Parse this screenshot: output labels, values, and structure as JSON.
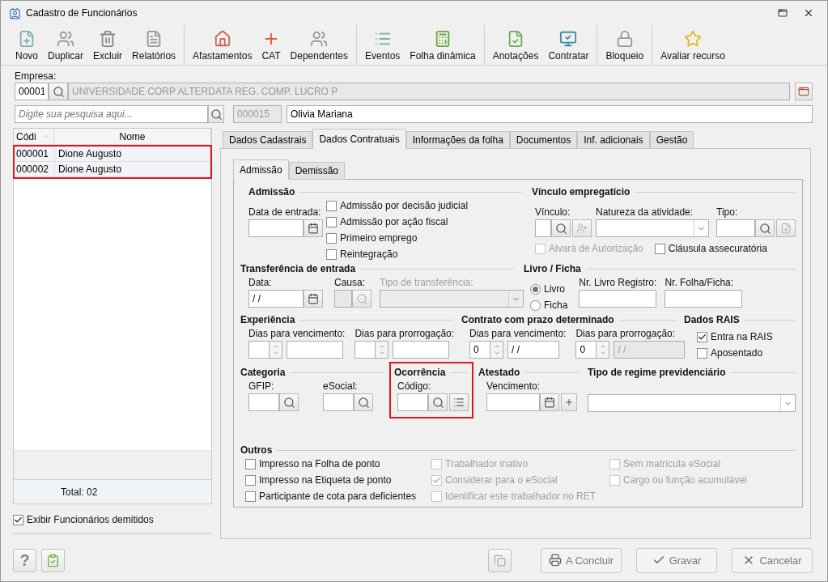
{
  "window": {
    "title": "Cadastro de Funcionários"
  },
  "toolbar": [
    [
      {
        "label": "Novo",
        "kind": "new"
      },
      {
        "label": "Duplicar",
        "kind": "people"
      },
      {
        "label": "Excluir",
        "kind": "trash"
      },
      {
        "label": "Relatórios",
        "kind": "report"
      }
    ],
    [
      {
        "label": "Afastamentos",
        "kind": "leave"
      },
      {
        "label": "CAT",
        "kind": "cross"
      },
      {
        "label": "Dependentes",
        "kind": "people"
      }
    ],
    [
      {
        "label": "Eventos",
        "kind": "list"
      },
      {
        "label": "Folha dinâmica",
        "kind": "calc"
      }
    ],
    [
      {
        "label": "Anotações",
        "kind": "note"
      },
      {
        "label": "Contratar",
        "kind": "hire"
      }
    ],
    [
      {
        "label": "Bloqueio",
        "kind": "lock"
      }
    ],
    [
      {
        "label": "Avaliar recurso",
        "kind": "star"
      }
    ]
  ],
  "empresa": {
    "label": "Empresa:",
    "code": "00001",
    "name": "UNIVERSIDADE CORP ALTERDATA REG. COMP. LUCRO P"
  },
  "search": {
    "placeholder": "Digite sua pesquisa aqui..."
  },
  "employee": {
    "code": "000015",
    "name": "Olivia Mariana"
  },
  "employee_list": {
    "columns": [
      "Códi",
      "Nome"
    ],
    "highlighted": true,
    "rows": [
      {
        "code": "000001",
        "name": "Dione Augusto"
      },
      {
        "code": "000002",
        "name": "Dione Augusto"
      }
    ],
    "total": "Total: 02"
  },
  "show_dismissed": {
    "label": "Exibir Funcionários demitidos",
    "checked": true
  },
  "help_button": "?",
  "tabs": [
    {
      "label": "Dados Cadastrais",
      "selected": false
    },
    {
      "label": "Dados Contratuais",
      "selected": true
    },
    {
      "label": "Informações da folha",
      "selected": false
    },
    {
      "label": "Documentos",
      "selected": false
    },
    {
      "label": "Inf. adicionais",
      "selected": false
    },
    {
      "label": "Gestão",
      "selected": false
    }
  ],
  "subtabs": [
    {
      "label": "Admissão",
      "selected": true
    },
    {
      "label": "Demissão",
      "selected": false
    }
  ],
  "admissao": {
    "title": "Admissão",
    "date_label": "Data de entrada:",
    "options": [
      {
        "label": "Admissão por decisão judicial",
        "checked": false,
        "disabled": false
      },
      {
        "label": "Admissão por ação fiscal",
        "checked": false,
        "disabled": false
      },
      {
        "label": "Primeiro emprego",
        "checked": false,
        "disabled": false
      },
      {
        "label": "Reintegração",
        "checked": false,
        "disabled": false
      }
    ]
  },
  "vinculo": {
    "title": "Vínculo empregatício",
    "vinculo_label": "Vínculo:",
    "natureza_label": "Natureza da atividade:",
    "tipo_label": "Tipo:",
    "options": [
      {
        "label": "Alvará de Autorização",
        "checked": false,
        "disabled": true
      },
      {
        "label": "Cláusula assecuratória",
        "checked": false,
        "disabled": false
      }
    ]
  },
  "transferencia": {
    "title": "Transferência de entrada",
    "data_label": "Data:",
    "data_value": "/ /",
    "causa_label": "Causa:",
    "tipo_label": "Tipo de transferência:",
    "tipo_disabled": true
  },
  "livro": {
    "title": "Livro / Ficha",
    "options": [
      {
        "label": "Livro",
        "selected": true
      },
      {
        "label": "Ficha",
        "selected": false
      }
    ],
    "registro_label": "Nr. Livro Registro:",
    "folha_label": "Nr. Folha/Ficha:"
  },
  "experiencia": {
    "title": "Experiência",
    "fields": [
      {
        "label": "Dias para vencimento:"
      },
      {
        "label": "Dias para prorrogação:"
      }
    ]
  },
  "contrato": {
    "title": "Contrato com prazo determinado",
    "fields": [
      {
        "label": "Dias para vencimento:",
        "count": "0",
        "date": "/ /",
        "disabled": false
      },
      {
        "label": "Dias para prorrogação:",
        "count": "0",
        "date": "/ /",
        "disabled": true
      }
    ]
  },
  "rais": {
    "title": "Dados RAIS",
    "options": [
      {
        "label": "Entra na RAIS",
        "checked": true,
        "disabled": false
      },
      {
        "label": "Aposentado",
        "checked": false,
        "disabled": false
      }
    ]
  },
  "categoria": {
    "title": "Categoria",
    "fields": [
      {
        "label": "GFIP:"
      },
      {
        "label": "eSocial:"
      }
    ]
  },
  "ocorrencia": {
    "title": "Ocorrência",
    "label": "Código:",
    "highlighted": true
  },
  "atestado": {
    "title": "Atestado",
    "label": "Vencimento:"
  },
  "regime": {
    "title": "Tipo de regime previdenciário"
  },
  "outros": {
    "title": "Outros",
    "columns": [
      [
        {
          "label": "Impresso na Folha de ponto",
          "checked": false,
          "disabled": false
        },
        {
          "label": "Impresso na Etiqueta de ponto",
          "checked": false,
          "disabled": false
        },
        {
          "label": "Participante de cota para deficientes",
          "checked": false,
          "disabled": false
        }
      ],
      [
        {
          "label": "Trabalhador inativo",
          "checked": false,
          "disabled": true
        },
        {
          "label": "Considerar para o eSocial",
          "checked": true,
          "disabled": true
        },
        {
          "label": "Identificar este trabalhador no RET",
          "checked": false,
          "disabled": true
        }
      ],
      [
        {
          "label": "Sem matrícula eSocial",
          "checked": false,
          "disabled": true
        },
        {
          "label": "Cargo ou função acumulável",
          "checked": false,
          "disabled": true
        }
      ]
    ]
  },
  "footer": {
    "buttons": [
      {
        "label": "A Concluir",
        "kind": "print"
      },
      {
        "label": "Gravar",
        "kind": "save"
      },
      {
        "label": "Cancelar",
        "kind": "cancel"
      }
    ]
  }
}
